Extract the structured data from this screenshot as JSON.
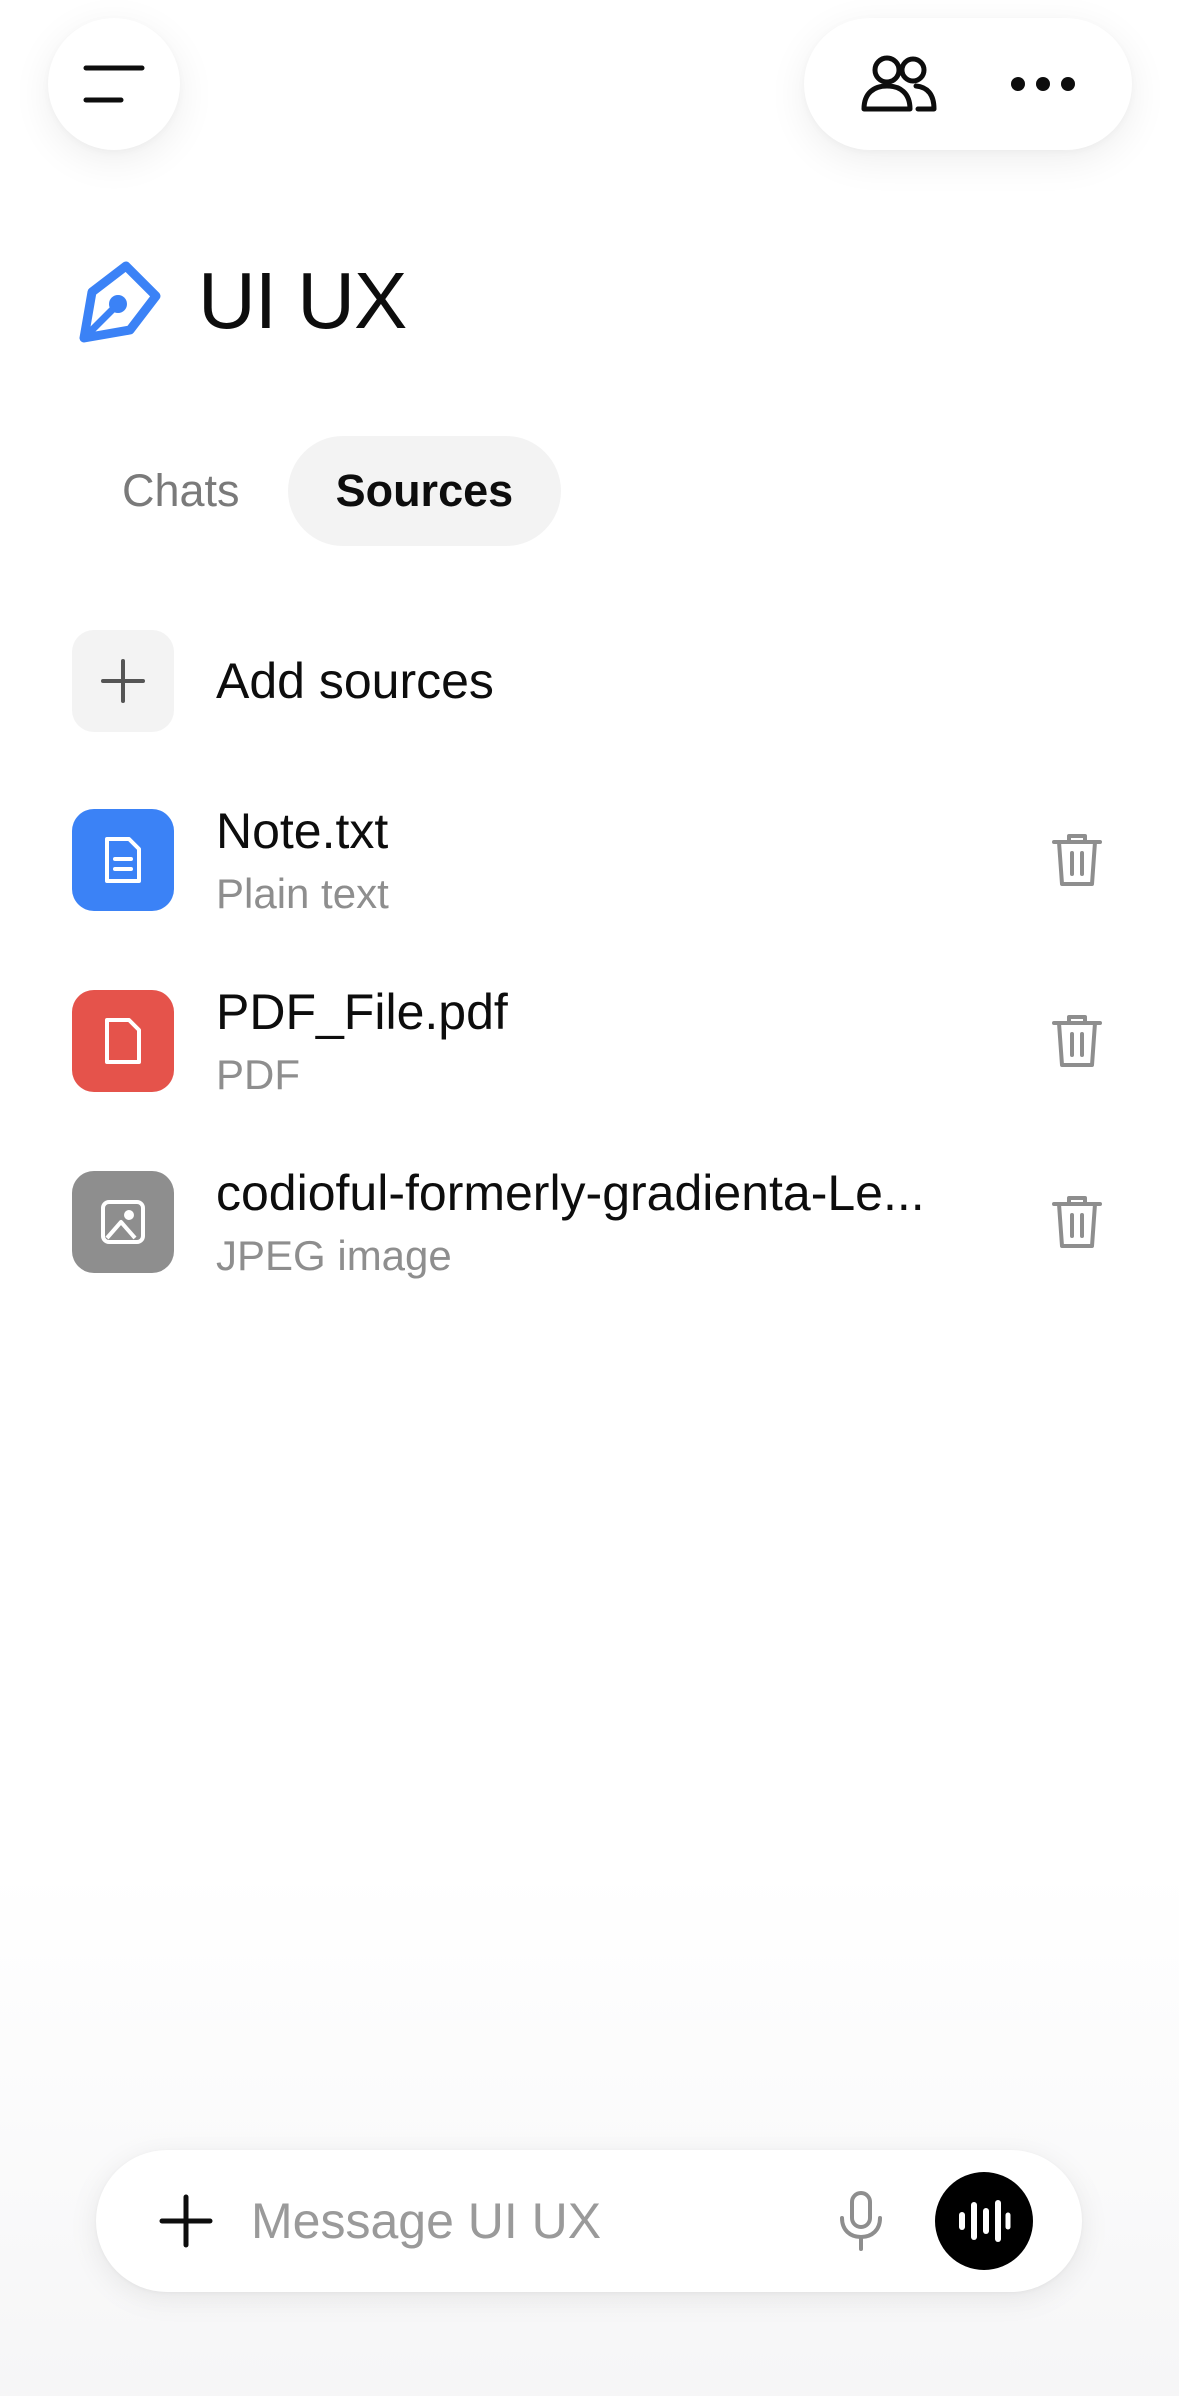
{
  "project": {
    "title": "UI UX",
    "icon": "pen-nib-icon",
    "accent": "#3b82f6"
  },
  "header": {
    "menu_icon": "menu-icon",
    "share_icon": "people-icon",
    "more_icon": "more-horizontal-icon"
  },
  "tabs": [
    {
      "label": "Chats",
      "active": false
    },
    {
      "label": "Sources",
      "active": true
    }
  ],
  "sources": {
    "add_label": "Add sources",
    "items": [
      {
        "name": "Note.txt",
        "type": "Plain text",
        "icon": "text-file-icon",
        "color": "#3b82f6"
      },
      {
        "name": "PDF_File.pdf",
        "type": "PDF",
        "icon": "pdf-file-icon",
        "color": "#e5534b"
      },
      {
        "name": "codioful-formerly-gradienta-Le...",
        "type": "JPEG image",
        "icon": "image-file-icon",
        "color": "#8e8e8e"
      }
    ]
  },
  "composer": {
    "placeholder": "Message UI UX"
  }
}
